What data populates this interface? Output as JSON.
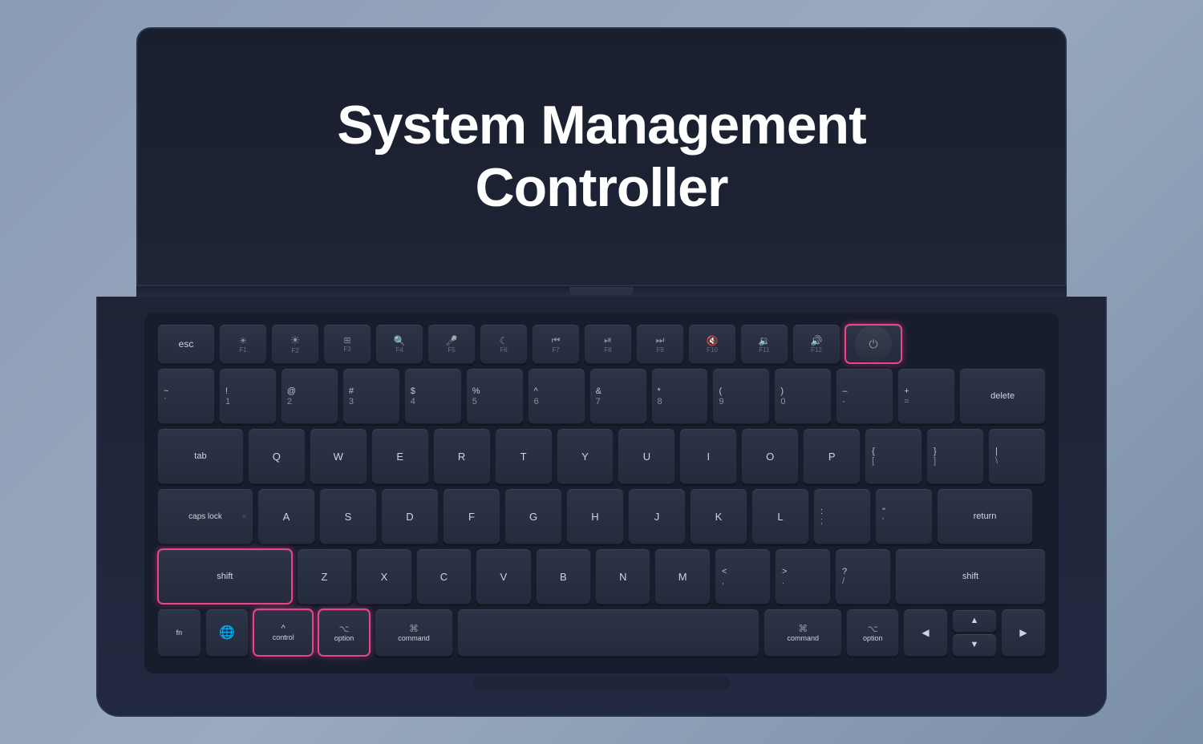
{
  "title": {
    "line1": "System Management",
    "line2": "Controller"
  },
  "keyboard": {
    "rows": {
      "fn_row": {
        "esc": "esc",
        "f1": "F1",
        "f2": "F2",
        "f3": "F3",
        "f4": "F4",
        "f5": "F5",
        "f6": "F6",
        "f7": "F7",
        "f8": "F8",
        "f9": "F9",
        "f10": "F10",
        "f11": "F11",
        "f12": "F12"
      },
      "number_row": {
        "keys": [
          "~`",
          "!1",
          "@2",
          "#3",
          "$4",
          "%5",
          "^6",
          "&7",
          "*8",
          "(9",
          ")0",
          "-_",
          "+=",
          "delete"
        ]
      },
      "qwerty": {
        "keys": [
          "Q",
          "W",
          "E",
          "R",
          "T",
          "Y",
          "U",
          "I",
          "O",
          "P"
        ]
      },
      "asdf": {
        "keys": [
          "A",
          "S",
          "D",
          "F",
          "G",
          "H",
          "J",
          "K",
          "L"
        ]
      },
      "zxcv": {
        "keys": [
          "Z",
          "X",
          "C",
          "V",
          "B",
          "N",
          "M"
        ]
      }
    },
    "highlighted_keys": [
      "shift_left",
      "control",
      "option_left",
      "power"
    ],
    "accent_color": "#e8458a"
  }
}
